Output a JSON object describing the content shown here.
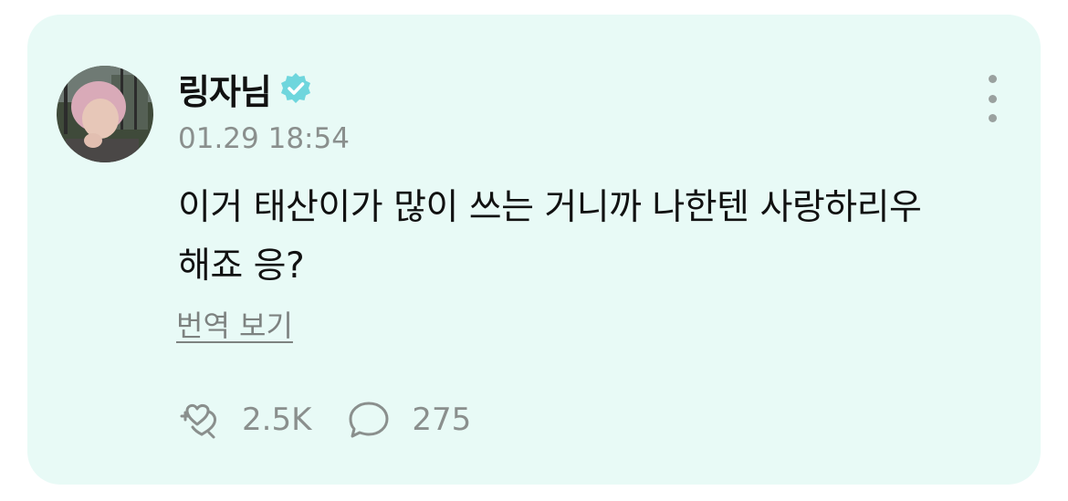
{
  "post": {
    "author_name": "링자님",
    "verified_icon": "verified-badge-icon",
    "timestamp": "01.29 18:54",
    "text_line1": "이거 태산이가 많이 쓰는 거니까 나한텐 사랑하리우",
    "text_line2": "해죠 응?",
    "translate_label": "번역 보기",
    "more_icon": "more-vertical-icon"
  },
  "actions": {
    "like_icon": "heart-icon",
    "like_count": "2.5K",
    "comment_icon": "comment-bubble-icon",
    "comment_count": "275"
  },
  "colors": {
    "card_background": "#e8faf6",
    "verified_badge": "#6fd6dd",
    "secondary_text": "#8a8f8d"
  }
}
